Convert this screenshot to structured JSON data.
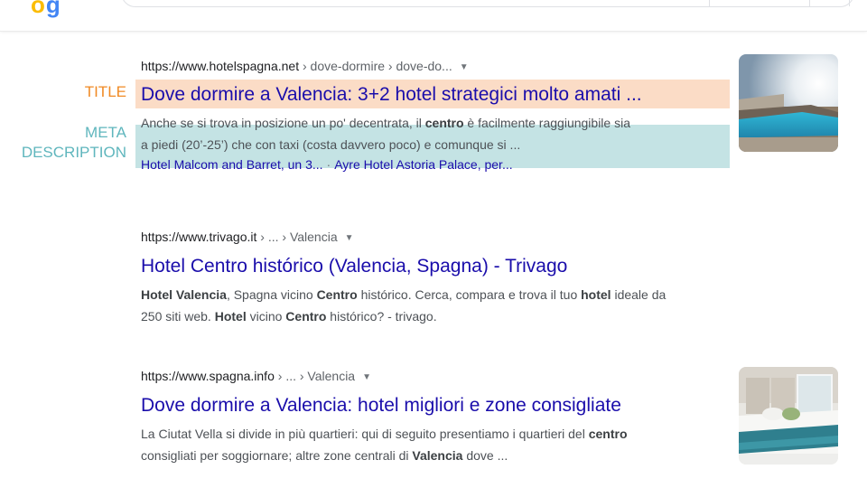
{
  "results": [
    {
      "url_domain": "https://www.hotelspagna.net",
      "url_path": " › dove-dormire › dove-do...",
      "title": "Dove dormire a Valencia: 3+2 hotel strategici molto amati ...",
      "snippet": {
        "line1_a": "Anche se si trova in posizione un po' decentrata, il ",
        "line1_b": "centro",
        "line1_c": " è facilmente raggiungibile sia",
        "line2": "a piedi (20’-25’) che con taxi (costa davvero poco) e comunque si ..."
      },
      "sitelinks": [
        "Hotel Malcom and Barret, un 3...",
        "Ayre Hotel Astoria Palace, per..."
      ],
      "sitelink_separator": "·"
    },
    {
      "url_domain": "https://www.trivago.it",
      "url_path": " › ... › Valencia",
      "title": "Hotel Centro histórico (Valencia, Spagna) - Trivago",
      "snippet": {
        "b1": "Hotel Valencia",
        "t1": ", Spagna vicino ",
        "b2": "Centro",
        "t2": " histórico. Cerca, compara e trova il tuo ",
        "b3": "hotel",
        "t3": " ideale da",
        "t4": "250 siti web. ",
        "b4": "Hotel",
        "t5": " vicino ",
        "b5": "Centro",
        "t6": " histórico? - trivago."
      }
    },
    {
      "url_domain": "https://www.spagna.info",
      "url_path": " › ... › Valencia",
      "title": "Dove dormire a Valencia: hotel migliori e zone consigliate",
      "snippet": {
        "t1": "La Ciutat Vella si divide in più quartieri: qui di seguito presentiamo i quartieri del ",
        "b1": "centro",
        "t2": "consigliati per soggiornare; altre zone centrali di ",
        "b2": "Valencia",
        "t3": " dove ..."
      }
    }
  ],
  "annotations": {
    "title_label": "TITLE",
    "meta_label_line1": "META",
    "meta_label_line2": "DESCRIPTION",
    "title_color": "#f08a24",
    "meta_color": "#5fb6bd"
  },
  "colors": {
    "link_blue": "#1a0dab",
    "title_highlight": "#fbdcc6",
    "meta_highlight": "#c4e3e4"
  },
  "icons": {
    "caret": "caret-down-icon"
  }
}
